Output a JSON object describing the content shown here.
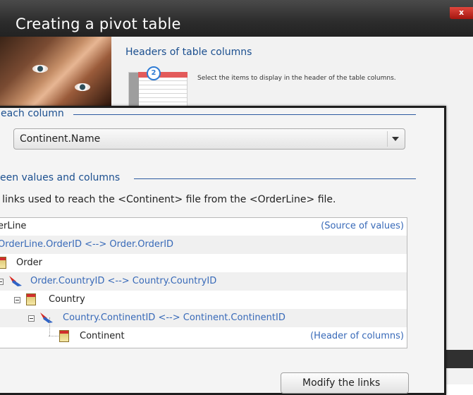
{
  "wizard": {
    "title": "Creating a pivot table",
    "close_label": "x",
    "step_heading": "Headers of table columns",
    "step_number": "2",
    "step_description": "Select the items to display in the header of the table columns."
  },
  "dialog": {
    "section1_legend": "each column",
    "combo_value": "Continent.Name",
    "section2_legend": "een values and columns",
    "info_text": "e links used to reach the <Continent> file from the <OrderLine> file.",
    "tree": {
      "rows": [
        {
          "label": "erLine",
          "side": "(Source of values)"
        },
        {
          "label": "OrderLine.OrderID <--> Order.OrderID"
        },
        {
          "label": "Order"
        },
        {
          "label": "Order.CountryID <--> Country.CountryID"
        },
        {
          "label": "Country"
        },
        {
          "label": "Country.ContinentID <--> Continent.ContinentID"
        },
        {
          "label": "Continent",
          "side": "(Header of columns)"
        }
      ]
    },
    "modify_button": "Modify the links"
  },
  "colors": {
    "accent_blue": "#1b4f8f",
    "link_blue": "#3769b8",
    "titlebar": "#2c2c2c",
    "close_red": "#c8241b"
  }
}
